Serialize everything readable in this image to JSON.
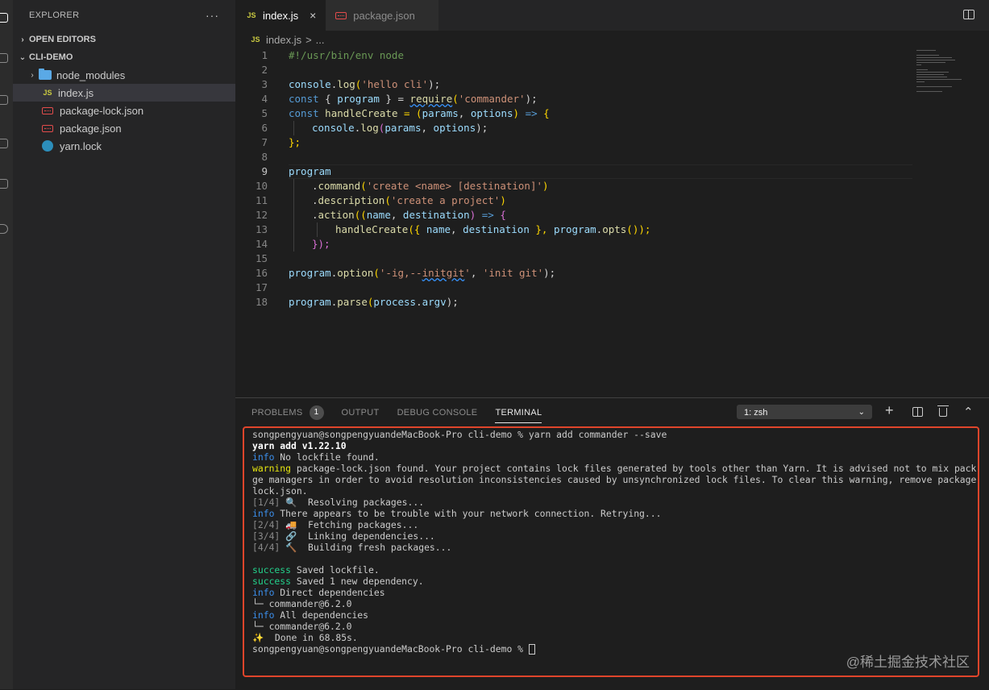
{
  "sidebar": {
    "title": "EXPLORER",
    "more": "···",
    "open_editors": "OPEN EDITORS",
    "project": "CLI-DEMO",
    "items": [
      {
        "label": "node_modules",
        "icon": "folder-icon"
      },
      {
        "label": "index.js",
        "icon": "js-file-icon"
      },
      {
        "label": "package-lock.json",
        "icon": "json-file-icon"
      },
      {
        "label": "package.json",
        "icon": "json-file-icon"
      },
      {
        "label": "yarn.lock",
        "icon": "yarn-file-icon"
      }
    ]
  },
  "editor": {
    "tabs": [
      {
        "label": "index.js",
        "icon_text": "JS",
        "close": "×"
      },
      {
        "label": "package.json"
      }
    ],
    "breadcrumb": {
      "icon_text": "JS",
      "file": "index.js",
      "sep": ">",
      "rest": "..."
    },
    "line_numbers": [
      "1",
      "2",
      "3",
      "4",
      "5",
      "6",
      "7",
      "8",
      "9",
      "10",
      "11",
      "12",
      "13",
      "14",
      "15",
      "16",
      "17",
      "18"
    ],
    "code": {
      "l1": "#!/usr/bin/env node",
      "l3": {
        "a": "console",
        "b": ".",
        "c": "log",
        "d": "(",
        "e": "'hello cli'",
        "f": ");"
      },
      "l4": {
        "a": "const",
        "b": " { ",
        "c": "program",
        "d": " } = ",
        "e": "require",
        "f": "(",
        "g": "'commander'",
        "h": ");"
      },
      "l5": {
        "a": "const",
        "b": " ",
        "c": "handleCreate",
        "d": " = (",
        "e": "params",
        "f": ", ",
        "g": "options",
        "h": ") ",
        "i": "=>",
        "j": " {"
      },
      "l6": {
        "a": "console",
        "b": ".",
        "c": "log",
        "d": "(",
        "e": "params",
        "f": ", ",
        "g": "options",
        "h": ");"
      },
      "l7": "};",
      "l9": "program",
      "l10": {
        "a": ".",
        "b": "command",
        "c": "(",
        "d": "'create <name> [destination]'",
        "e": ")"
      },
      "l11": {
        "a": ".",
        "b": "description",
        "c": "(",
        "d": "'create a project'",
        "e": ")"
      },
      "l12": {
        "a": ".",
        "b": "action",
        "c": "((",
        "d": "name",
        "e": ", ",
        "f": "destination",
        "g": ") ",
        "h": "=>",
        "i": " {"
      },
      "l13": {
        "a": "handleCreate",
        "b": "({ ",
        "c": "name",
        "d": ", ",
        "e": "destination",
        "f": " }, ",
        "g": "program",
        "h": ".",
        "i": "opts",
        "j": "());"
      },
      "l14": "});",
      "l16": {
        "a": "program",
        "b": ".",
        "c": "option",
        "d": "(",
        "e": "'-ig,--",
        "f": "initgit",
        "g": "'",
        "h": ", ",
        "i": "'init git'",
        "j": ");"
      },
      "l18": {
        "a": "program",
        "b": ".",
        "c": "parse",
        "d": "(",
        "e": "process",
        "f": ".",
        "g": "argv",
        "h": ");"
      }
    }
  },
  "panel": {
    "tabs": {
      "problems": "PROBLEMS",
      "problems_count": "1",
      "output": "OUTPUT",
      "debug": "DEBUG CONSOLE",
      "terminal": "TERMINAL"
    },
    "shell_select": "1: zsh",
    "add": "+",
    "collapse": "⌃",
    "terminal_lines": [
      {
        "text": "songpengyuan@songpengyuandeMacBook-Pro cli-demo % yarn add commander --save"
      },
      {
        "text": "yarn add v1.22.10"
      },
      {
        "prefix": "info",
        "text": " No lockfile found."
      },
      {
        "prefix": "warning",
        "text": " package-lock.json found. Your project contains lock files generated by tools other than Yarn. It is advised not to mix pack"
      },
      {
        "text": "ge managers in order to avoid resolution inconsistencies caused by unsynchronized lock files. To clear this warning, remove package-"
      },
      {
        "text": "lock.json."
      },
      {
        "prefix": "[1/4]",
        "text": " 🔍  Resolving packages..."
      },
      {
        "prefix": "info",
        "text": " There appears to be trouble with your network connection. Retrying..."
      },
      {
        "prefix": "[2/4]",
        "text": " 🚚  Fetching packages..."
      },
      {
        "prefix": "[3/4]",
        "text": " 🔗  Linking dependencies..."
      },
      {
        "prefix": "[4/4]",
        "text": " 🔨  Building fresh packages..."
      },
      {
        "text": ""
      },
      {
        "prefix": "success",
        "text": " Saved lockfile."
      },
      {
        "prefix": "success",
        "text": " Saved 1 new dependency."
      },
      {
        "prefix": "info",
        "text": " Direct dependencies"
      },
      {
        "text": "└─ commander@6.2.0"
      },
      {
        "prefix": "info",
        "text": " All dependencies"
      },
      {
        "text": "└─ commander@6.2.0"
      },
      {
        "text": "✨  Done in 68.85s."
      },
      {
        "text": "songpengyuan@songpengyuandeMacBook-Pro cli-demo % "
      }
    ]
  },
  "watermark": "@稀土掘金技术社区"
}
